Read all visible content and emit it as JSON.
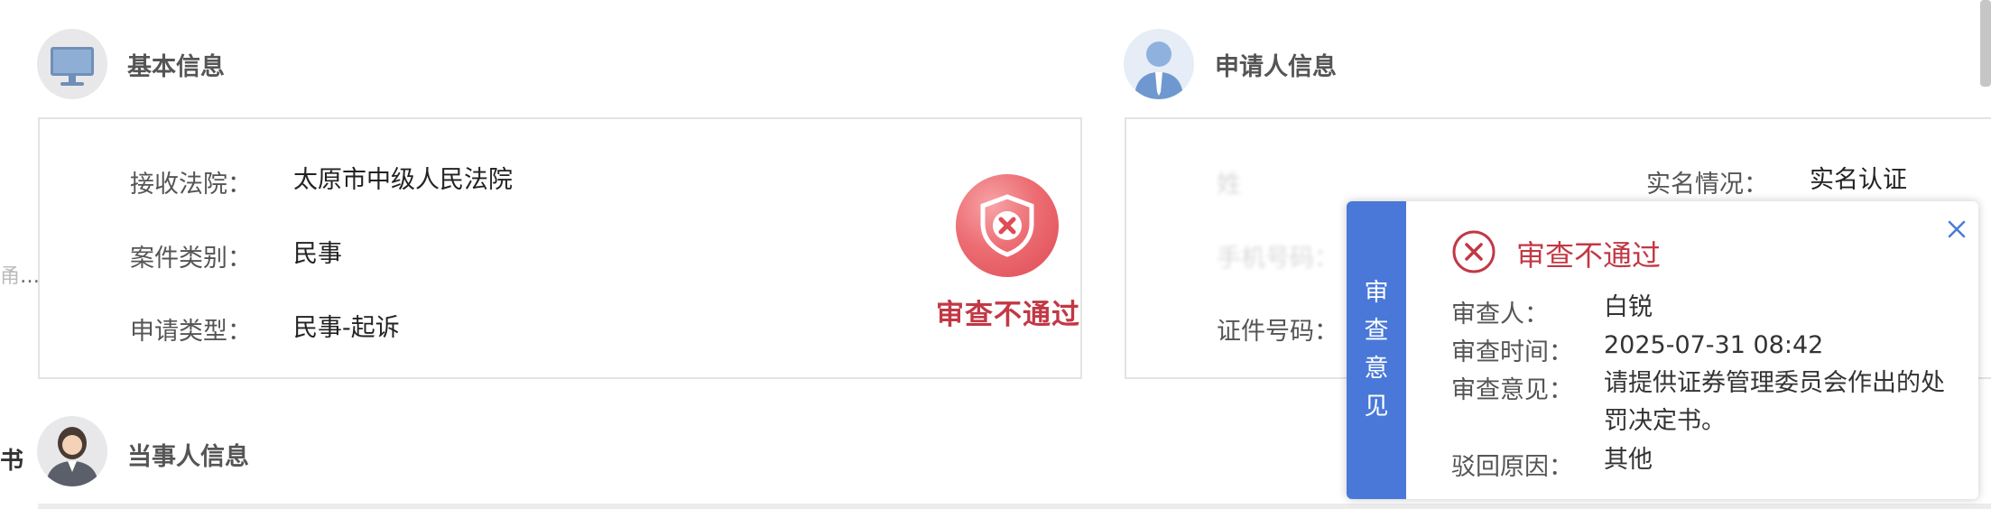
{
  "edge": {
    "ellipsis_text": "…",
    "partial_char": "书"
  },
  "basic_info": {
    "title": "基本信息",
    "icon": "monitor-icon",
    "fields": [
      {
        "label": "接收法院：",
        "value": "太原市中级人民法院"
      },
      {
        "label": "案件类别：",
        "value": "民事"
      },
      {
        "label": "申请类型：",
        "value": "民事-起诉"
      }
    ],
    "stamp": {
      "icon": "shield-x-icon",
      "text": "审查不通过"
    }
  },
  "applicant_info": {
    "title": "申请人信息",
    "icon": "person-male-icon",
    "fields": {
      "name_label": "姓",
      "phone_label": "手机号码：",
      "id_label": "证件号码：",
      "realname_label": "实名情况：",
      "realname_value": "实名认证"
    }
  },
  "party_info": {
    "title": "当事人信息",
    "icon": "person-female-icon"
  },
  "review_panel": {
    "tab_label": [
      "审",
      "查",
      "意",
      "见"
    ],
    "status_icon": "x-circle-icon",
    "status": "审查不通过",
    "close_icon": "close-icon",
    "rows": [
      {
        "label": "审查人：",
        "value": "白锐"
      },
      {
        "label": "审查时间：",
        "value": "2025-07-31 08:42"
      },
      {
        "label": "审查意见：",
        "value": "请提供证券管理委员会作出的处罚决定书。"
      },
      {
        "label": "驳回原因：",
        "value": "其他"
      }
    ]
  },
  "colors": {
    "accent": "#4978d8",
    "reject": "#c23845",
    "border": "#e3e3e3"
  }
}
